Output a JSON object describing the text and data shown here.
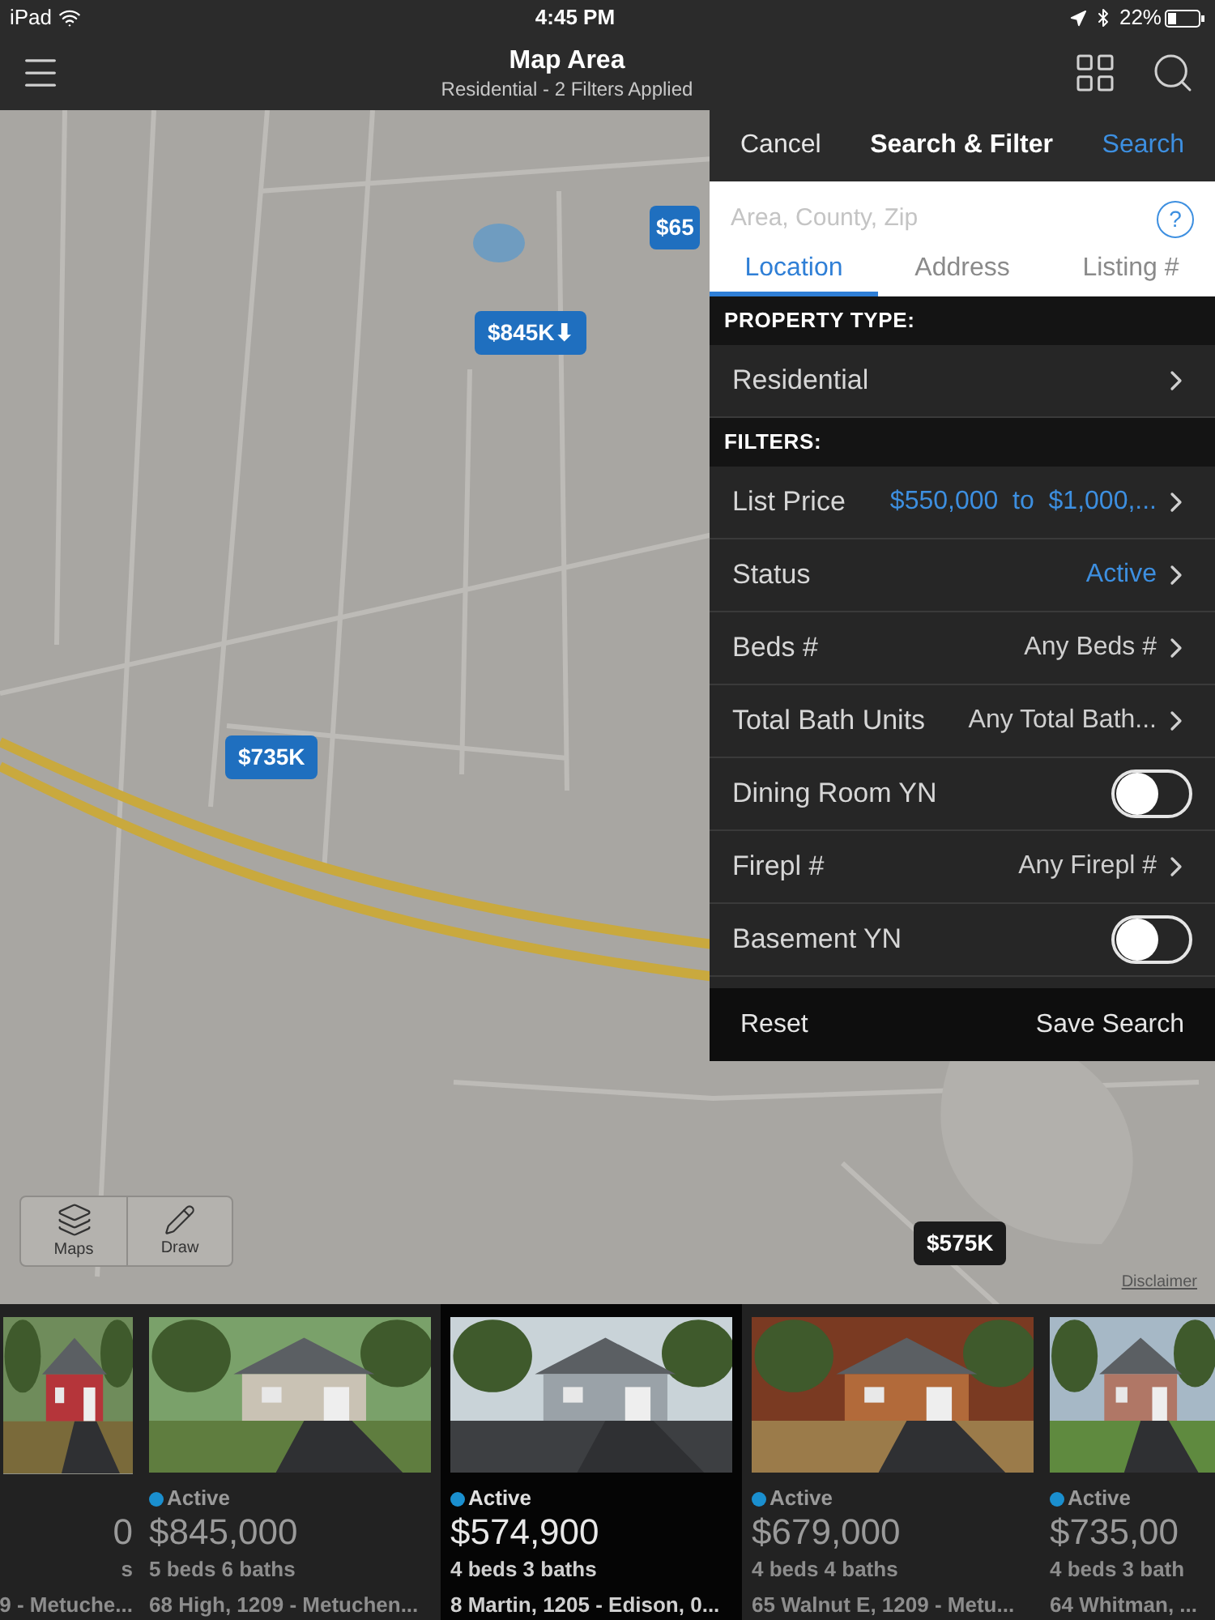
{
  "status_bar": {
    "device": "iPad",
    "time": "4:45 PM",
    "battery": "22%"
  },
  "nav": {
    "title": "Map Area",
    "subtitle": "Residential - 2 Filters Applied"
  },
  "map": {
    "kind": "picture",
    "pins": [
      {
        "label": "$65",
        "selected": false
      },
      {
        "label": "$845K⬇",
        "selected": false
      },
      {
        "label": "$735K",
        "selected": false
      },
      {
        "label": "$575K",
        "selected": true
      }
    ],
    "tools": [
      "Maps",
      "Draw"
    ],
    "disclaimer": "Disclaimer"
  },
  "panel": {
    "cancel": "Cancel",
    "title": "Search & Filter",
    "search": "Search",
    "placeholder": "Area, County, Zip",
    "help": "?",
    "tabs": [
      {
        "label": "Location",
        "selected": true
      },
      {
        "label": "Address",
        "selected": false
      },
      {
        "label": "Listing #",
        "selected": false
      }
    ],
    "sections": [
      {
        "title": "PROPERTY TYPE:",
        "rows": [
          {
            "kind": "chevron",
            "label": "Residential"
          }
        ]
      },
      {
        "title": "FILTERS:",
        "rows": [
          {
            "kind": "chevron",
            "label": "List Price",
            "value": "$550,000  to  $1,000,...",
            "highlighted": true
          },
          {
            "kind": "chevron",
            "label": "Status",
            "value": "Active",
            "highlighted": true
          },
          {
            "kind": "chevron",
            "label": "Beds #",
            "value": "Any Beds #",
            "highlighted": false
          },
          {
            "kind": "chevron",
            "label": "Total Bath Units",
            "value": "Any Total Bath...",
            "highlighted": false
          },
          {
            "kind": "toggle",
            "label": "Dining Room YN",
            "on": false
          },
          {
            "kind": "chevron",
            "label": "Firepl #",
            "value": "Any Firepl #",
            "highlighted": false
          },
          {
            "kind": "toggle",
            "label": "Basement YN",
            "on": false
          }
        ]
      }
    ],
    "reset": "Reset",
    "save": "Save Search"
  },
  "listings": [
    {
      "price": "0",
      "beds": "s",
      "address": "9 - Metuche...",
      "selected": false
    },
    {
      "status": "Active",
      "price": "$845,000",
      "beds": "5 beds 6 baths",
      "address": "68 High, 1209 - Metuchen...",
      "selected": false
    },
    {
      "status": "Active",
      "price": "$574,900",
      "beds": "4 beds 3 baths",
      "address": "8 Martin, 1205 - Edison, 0...",
      "selected": true
    },
    {
      "status": "Active",
      "price": "$679,000",
      "beds": "4 beds 4 baths",
      "address": "65 Walnut E, 1209 - Metu...",
      "selected": false
    },
    {
      "status": "Active",
      "price": "$735,00",
      "beds": "4 beds 3 bath",
      "address": "64 Whitman, ...",
      "selected": false
    }
  ]
}
